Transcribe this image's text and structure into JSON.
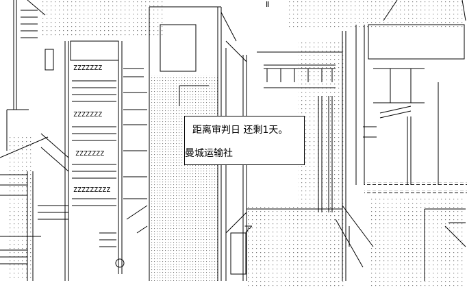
{
  "caption": {
    "line1": "距离审判日 还剩1天。",
    "line2": "曼城运输社"
  },
  "signage": {
    "zrows": [
      "ZZZZZZZ",
      "ZZZZZZZ",
      "ZZZZZZZ",
      "ZZZZZZZZZ"
    ],
    "katakana": "ア",
    "small_label": "Ⅱ"
  },
  "colors": {
    "ink": "#000000",
    "paper": "#ffffff",
    "dots": "#7a7a7a"
  }
}
